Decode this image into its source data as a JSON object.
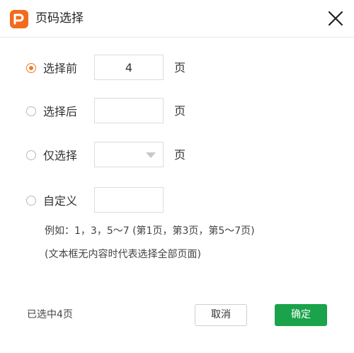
{
  "dialog": {
    "title": "页码选择",
    "logo_icon": "pdf-app-logo-icon",
    "close_icon": "close-icon"
  },
  "options": [
    {
      "label": "选择前",
      "value": "4",
      "unit": "页",
      "selected": true,
      "control": "text-input"
    },
    {
      "label": "选择后",
      "value": "",
      "unit": "页",
      "selected": false,
      "control": "text-input"
    },
    {
      "label": "仅选择",
      "value": "",
      "unit": "页",
      "selected": false,
      "control": "dropdown"
    },
    {
      "label": "自定义",
      "value": "",
      "selected": false,
      "control": "text-input"
    }
  ],
  "hints": {
    "example": "例如：1，3，5～7 (第1页，第3页，第5～7页)",
    "note": "(文本框无内容时代表选择全部页面)"
  },
  "footer": {
    "status": "已选中4页",
    "cancel_label": "取消",
    "ok_label": "确定"
  },
  "colors": {
    "accent": "#f07b2b",
    "logo": "#f26b1d",
    "primary_button": "#1aa34a"
  }
}
